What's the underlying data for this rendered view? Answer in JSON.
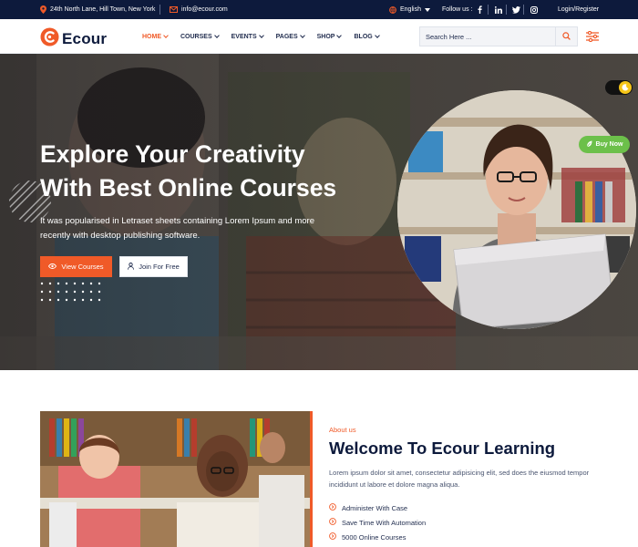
{
  "topbar": {
    "address": "24th North Lane, Hill Town, New York",
    "email": "info@ecour.com",
    "language": "English",
    "follow_label": "Follow us :",
    "social": [
      "facebook-icon",
      "linkedin-icon",
      "twitter-icon",
      "instagram-icon"
    ],
    "auth_label": "Login/Register"
  },
  "header": {
    "logo_text": "Ecour",
    "nav": [
      {
        "label": "HOME",
        "active": true
      },
      {
        "label": "COURSES",
        "active": false
      },
      {
        "label": "EVENTS",
        "active": false
      },
      {
        "label": "PAGES",
        "active": false
      },
      {
        "label": "SHOP",
        "active": false
      },
      {
        "label": "BLOG",
        "active": false
      }
    ],
    "search_placeholder": "Search Here ..."
  },
  "hero": {
    "title_line1": "Explore Your Creativity",
    "title_line2": "With Best Online Courses",
    "text": "It was popularised in Letraset sheets containing Lorem Ipsum and more recently with desktop publishing software.",
    "primary_button": "View Courses",
    "secondary_button": "Join For Free",
    "buy_now": "Buy Now"
  },
  "about": {
    "kicker": "About us",
    "title": "Welcome To Ecour Learning",
    "text": "Lorem ipsum dolor sit amet, consectetur adipisicing elit, sed does the eiusmod tempor incididunt ut labore et dolore magna aliqua.",
    "list": [
      "Administer With Case",
      "Save Time With Automation",
      "5000 Online Courses"
    ]
  },
  "colors": {
    "accent": "#f05a28",
    "navy": "#0d1a3c",
    "green": "#6cc04a",
    "topbar": "#0d1a3c"
  }
}
